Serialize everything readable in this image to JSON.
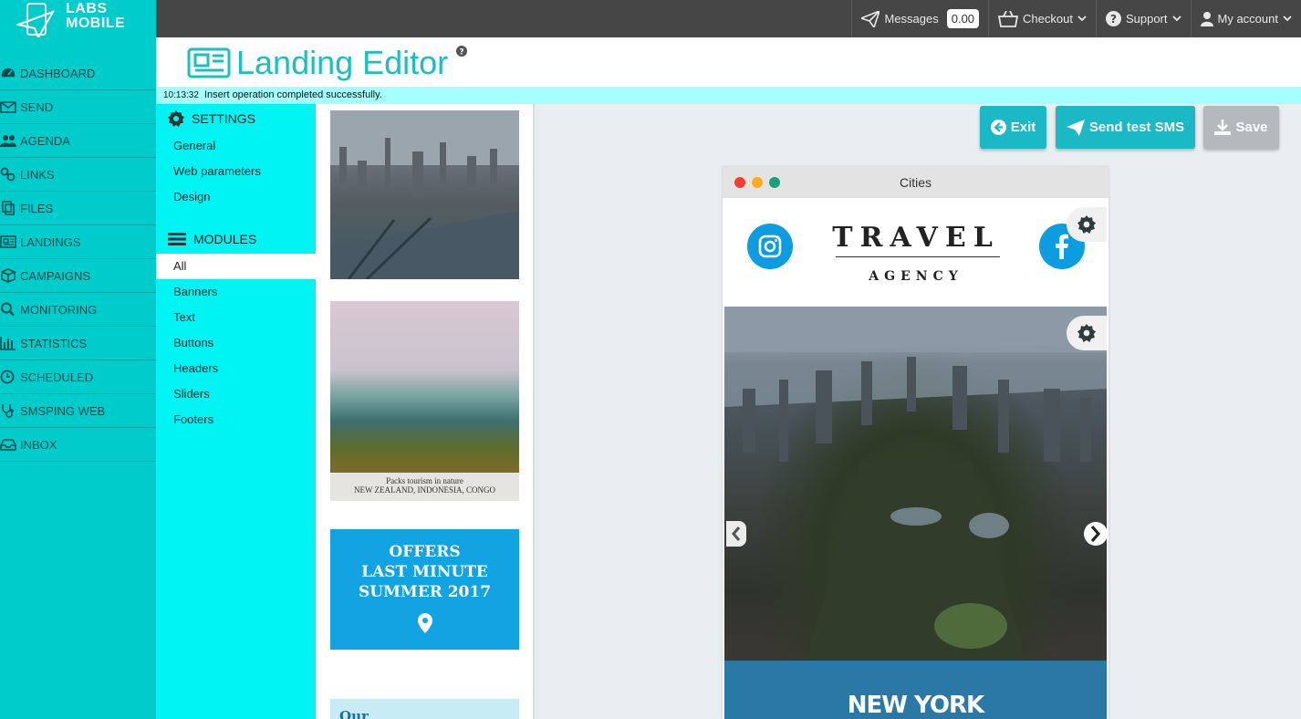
{
  "app": {
    "logo_line1": "LABS",
    "logo_line2": "MOBILE",
    "brand_color": "#00cccc"
  },
  "topnav": {
    "messages_label": "Messages",
    "messages_balance": "0.00",
    "checkout_label": "Checkout",
    "support_label": "Support",
    "account_label": "My account"
  },
  "sidebar": {
    "items": [
      {
        "label": "DASHBOARD",
        "icon": "dashboard-icon"
      },
      {
        "label": "SEND",
        "icon": "envelope-icon"
      },
      {
        "label": "AGENDA",
        "icon": "users-icon"
      },
      {
        "label": "LINKS",
        "icon": "link-icon"
      },
      {
        "label": "FILES",
        "icon": "files-icon"
      },
      {
        "label": "LANDINGS",
        "icon": "newspaper-icon"
      },
      {
        "label": "CAMPAIGNS",
        "icon": "cube-icon"
      },
      {
        "label": "MONITORING",
        "icon": "search-icon"
      },
      {
        "label": "STATISTICS",
        "icon": "bar-chart-icon"
      },
      {
        "label": "SCHEDULED",
        "icon": "clock-icon"
      },
      {
        "label": "SMSPING WEB",
        "icon": "stethoscope-icon"
      },
      {
        "label": "INBOX",
        "icon": "inbox-icon"
      }
    ]
  },
  "header": {
    "title": "Landing Editor"
  },
  "status": {
    "time": "10:13:32",
    "message": "Insert operation completed successfully."
  },
  "panel": {
    "settings_heading": "SETTINGS",
    "settings_links": [
      "General",
      "Web parameters",
      "Design"
    ],
    "modules_heading": "MODULES",
    "module_links": [
      "All",
      "Banners",
      "Text",
      "Buttons",
      "Headers",
      "Sliders",
      "Footers"
    ],
    "active_module": "All"
  },
  "modules": {
    "coast_caption_line1": "Packs tourism in nature",
    "coast_caption_line2": "NEW ZEALAND, INDONESIA, CONGO",
    "offer_line1": "OFFERS",
    "offer_line2": "LAST MINUTE",
    "offer_line3": "SUMMER 2017",
    "our_text": "Our"
  },
  "actions": {
    "exit_label": "Exit",
    "send_test_label": "Send test SMS",
    "save_label": "Save"
  },
  "preview": {
    "window_title": "Cities",
    "brand_main": "TRAVEL",
    "brand_sub": "AGENCY",
    "slide_caption": "NEW YORK",
    "dot_colors": [
      "#fc3a2e",
      "#fdac1e",
      "#19a07a"
    ]
  }
}
